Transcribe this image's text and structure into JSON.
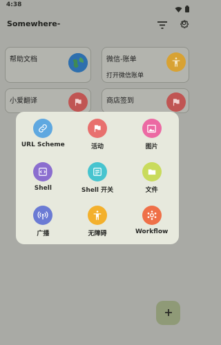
{
  "status_bar": {
    "time": "4:38"
  },
  "app_bar": {
    "title": "Somewhere-"
  },
  "cards": [
    {
      "title": "帮助文档",
      "subtitle": "",
      "icon": "globe-icon",
      "icon_color": "#2f73b5"
    },
    {
      "title": "微信-账单",
      "subtitle": "打开微信账单",
      "icon": "accessibility-icon",
      "icon_color": "#d8a233"
    },
    {
      "title": "小爱翻译",
      "subtitle": "",
      "icon": "flag-icon",
      "icon_color": "#c05553"
    },
    {
      "title": "商店签到",
      "subtitle": "",
      "icon": "flag-icon",
      "icon_color": "#c05553"
    }
  ],
  "popup": {
    "items": [
      {
        "label": "URL Scheme",
        "icon": "link-icon",
        "color": "#5fa8e0"
      },
      {
        "label": "活动",
        "icon": "flag-icon",
        "color": "#e8706e"
      },
      {
        "label": "图片",
        "icon": "image-icon",
        "color": "#ec69a3"
      },
      {
        "label": "Shell",
        "icon": "code-icon",
        "color": "#8b6ecf"
      },
      {
        "label": "Shell 开关",
        "icon": "list-icon",
        "color": "#47c4cf"
      },
      {
        "label": "文件",
        "icon": "folder-icon",
        "color": "#c9db5c"
      },
      {
        "label": "广播",
        "icon": "broadcast-icon",
        "color": "#6b7bd4"
      },
      {
        "label": "无障碍",
        "icon": "accessibility-icon",
        "color": "#f3b02c"
      },
      {
        "label": "Workflow",
        "icon": "workflow-icon",
        "color": "#ef7048"
      }
    ]
  },
  "fab": {
    "icon": "plus-icon"
  }
}
